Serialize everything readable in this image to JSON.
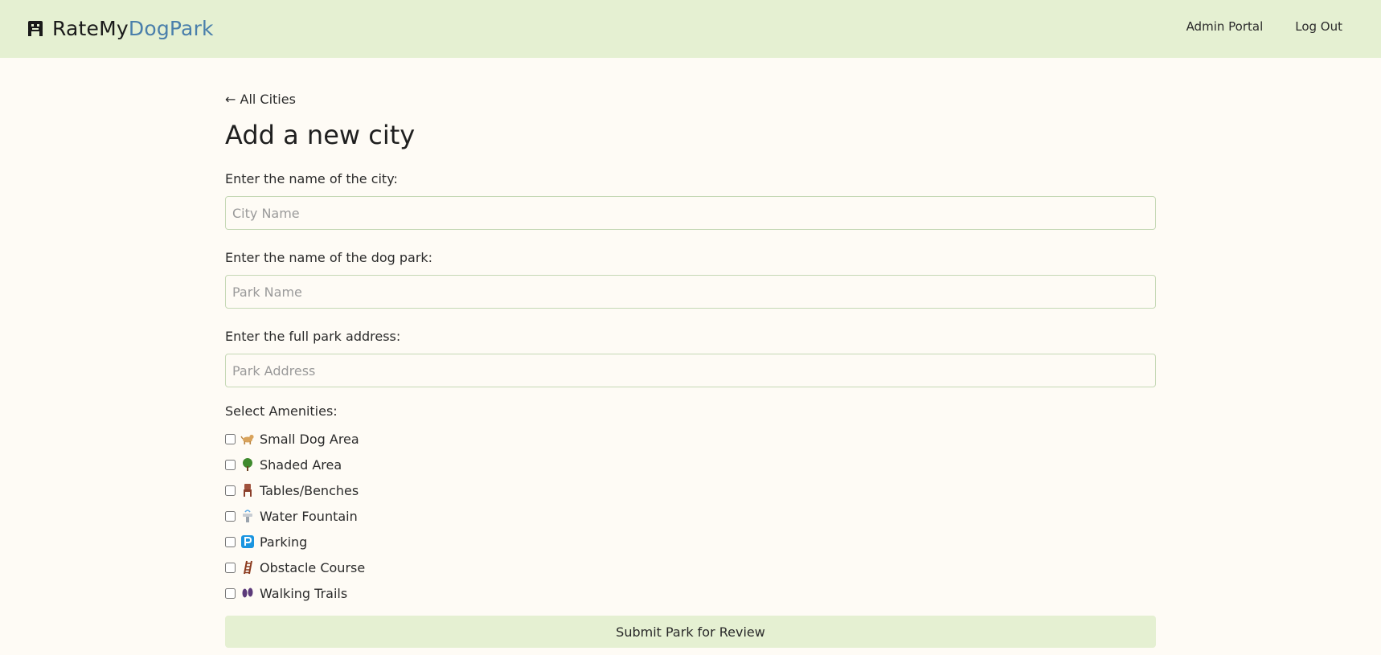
{
  "navbar": {
    "brand_part1": "RateMy",
    "brand_part2": "DogPark",
    "brand_icon": "dog-icon",
    "links": [
      "Admin Portal",
      "Log Out"
    ]
  },
  "form": {
    "back_link": "← All Cities",
    "title": "Add a new city",
    "city_label": "Enter the name of the city:",
    "city_placeholder": "City Name",
    "park_label": "Enter the name of the dog park:",
    "park_placeholder": "Park Name",
    "address_label": "Enter the full park address:",
    "address_placeholder": "Park Address",
    "amenities_label": "Select Amenities:",
    "amenities": [
      {
        "name": "Small Dog Area",
        "icon": "small-dog-icon",
        "checked": false
      },
      {
        "name": "Shaded Area",
        "icon": "tree-icon",
        "checked": false
      },
      {
        "name": "Tables/Benches",
        "icon": "chair-icon",
        "checked": false
      },
      {
        "name": "Water Fountain",
        "icon": "water-fountain-icon",
        "checked": false
      },
      {
        "name": "Parking",
        "icon": "parking-icon",
        "checked": false
      },
      {
        "name": "Obstacle Course",
        "icon": "ladder-icon",
        "checked": false
      },
      {
        "name": "Walking Trails",
        "icon": "footprints-icon",
        "checked": false
      }
    ],
    "submit_label": "Submit Park for Review"
  },
  "colors": {
    "navbar_bg": "#e5f0d2",
    "page_bg": "#fefbf5",
    "brand_accent": "#4a7fab",
    "input_border": "#c5d8b5"
  }
}
